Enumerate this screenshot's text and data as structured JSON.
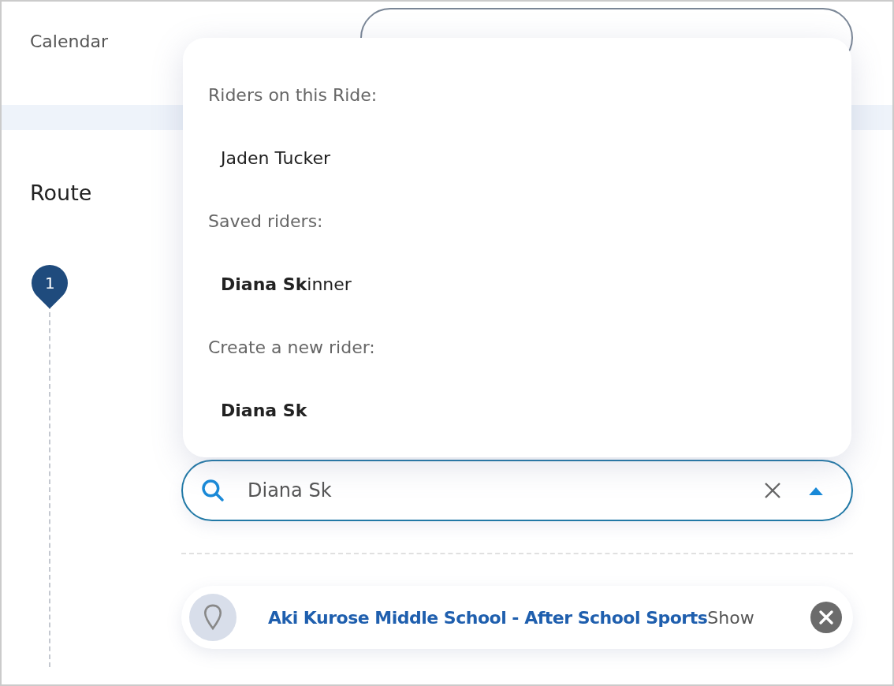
{
  "calendar": {
    "label": "Calendar"
  },
  "route": {
    "heading": "Route",
    "stop_number": "1"
  },
  "rider_dropdown": {
    "sections": [
      {
        "heading": "Riders on this Ride:",
        "options": [
          "Jaden Tucker"
        ]
      },
      {
        "heading": "Saved riders:",
        "options": [
          "**Diana Sk**inner"
        ]
      },
      {
        "heading": "Create a new rider:",
        "options": [
          "**Diana Sk**"
        ]
      }
    ]
  },
  "rider_search": {
    "value": "Diana Sk",
    "expanded": true
  },
  "stop": {
    "name": "Aki Kurose Middle School - After School Sports",
    "action": "Show"
  }
}
